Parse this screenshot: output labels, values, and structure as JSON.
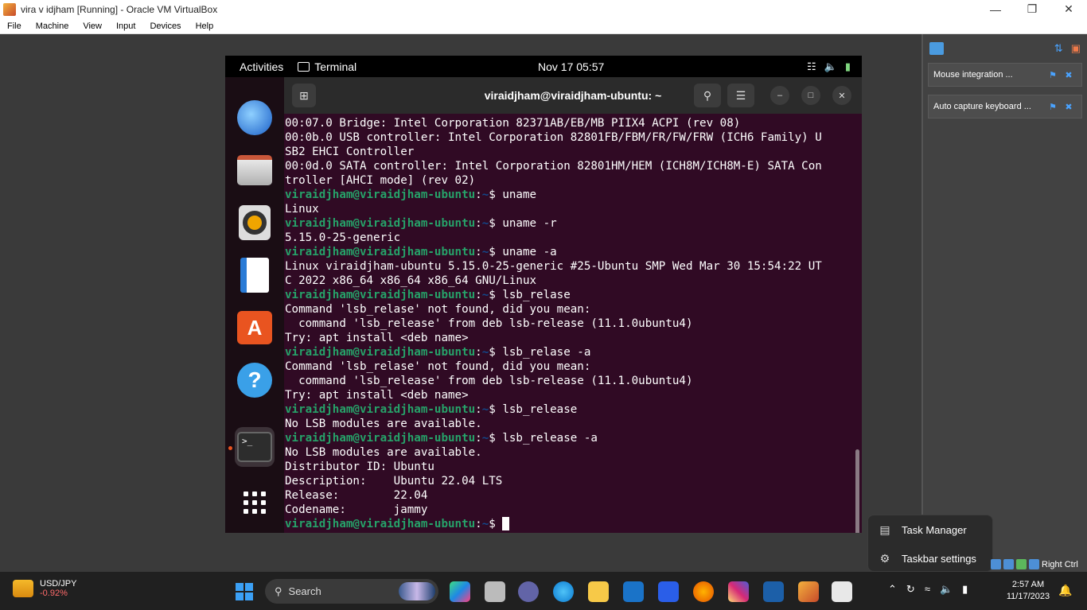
{
  "vbox": {
    "window_title": "vira v idjham  [Running] - Oracle VM VirtualBox",
    "menu": [
      "File",
      "Machine",
      "View",
      "Input",
      "Devices",
      "Help"
    ],
    "notifications": [
      {
        "text": "Mouse integration ..."
      },
      {
        "text": "Auto capture keyboard ..."
      }
    ],
    "host_key_label": "Right Ctrl"
  },
  "gnome": {
    "activities": "Activities",
    "app_name": "Terminal",
    "clock": "Nov 17  05:57"
  },
  "terminal": {
    "title": "viraidjham@viraidjham-ubuntu: ~",
    "prompt_user": "viraidjham@viraidjham-ubuntu",
    "prompt_path": "~",
    "lines": [
      {
        "t": "out",
        "text": "00:07.0 Bridge: Intel Corporation 82371AB/EB/MB PIIX4 ACPI (rev 08)"
      },
      {
        "t": "out",
        "text": "00:0b.0 USB controller: Intel Corporation 82801FB/FBM/FR/FW/FRW (ICH6 Family) U"
      },
      {
        "t": "out",
        "text": "SB2 EHCI Controller"
      },
      {
        "t": "out",
        "text": "00:0d.0 SATA controller: Intel Corporation 82801HM/HEM (ICH8M/ICH8M-E) SATA Con"
      },
      {
        "t": "out",
        "text": "troller [AHCI mode] (rev 02)"
      },
      {
        "t": "cmd",
        "text": "uname"
      },
      {
        "t": "out",
        "text": "Linux"
      },
      {
        "t": "cmd",
        "text": "uname -r"
      },
      {
        "t": "out",
        "text": "5.15.0-25-generic"
      },
      {
        "t": "cmd",
        "text": "uname -a"
      },
      {
        "t": "out",
        "text": "Linux viraidjham-ubuntu 5.15.0-25-generic #25-Ubuntu SMP Wed Mar 30 15:54:22 UT"
      },
      {
        "t": "out",
        "text": "C 2022 x86_64 x86_64 x86_64 GNU/Linux"
      },
      {
        "t": "cmd",
        "text": "lsb_relase"
      },
      {
        "t": "out",
        "text": "Command 'lsb_relase' not found, did you mean:"
      },
      {
        "t": "out",
        "text": "  command 'lsb_release' from deb lsb-release (11.1.0ubuntu4)"
      },
      {
        "t": "out",
        "text": "Try: apt install <deb name>"
      },
      {
        "t": "cmd",
        "text": "lsb_relase -a"
      },
      {
        "t": "out",
        "text": "Command 'lsb_relase' not found, did you mean:"
      },
      {
        "t": "out",
        "text": "  command 'lsb_release' from deb lsb-release (11.1.0ubuntu4)"
      },
      {
        "t": "out",
        "text": "Try: apt install <deb name>"
      },
      {
        "t": "cmd",
        "text": "lsb_release"
      },
      {
        "t": "out",
        "text": "No LSB modules are available."
      },
      {
        "t": "cmd",
        "text": "lsb_release -a"
      },
      {
        "t": "out",
        "text": "No LSB modules are available."
      },
      {
        "t": "out",
        "text": "Distributor ID:\tUbuntu"
      },
      {
        "t": "out",
        "text": "Description:\tUbuntu 22.04 LTS"
      },
      {
        "t": "out",
        "text": "Release:\t22.04"
      },
      {
        "t": "out",
        "text": "Codename:\tjammy"
      },
      {
        "t": "cmd",
        "text": ""
      }
    ]
  },
  "context_menu": {
    "task_manager": "Task Manager",
    "taskbar_settings": "Taskbar settings"
  },
  "taskbar": {
    "ticker_symbol": "USD/JPY",
    "ticker_change": "-0.92%",
    "search_label": "Search",
    "time": "2:57 AM",
    "date": "11/17/2023"
  },
  "colors": {
    "terminal_bg": "#300a24",
    "prompt_user": "#26a269",
    "prompt_path": "#12488b",
    "ubuntu_orange": "#e95420"
  }
}
